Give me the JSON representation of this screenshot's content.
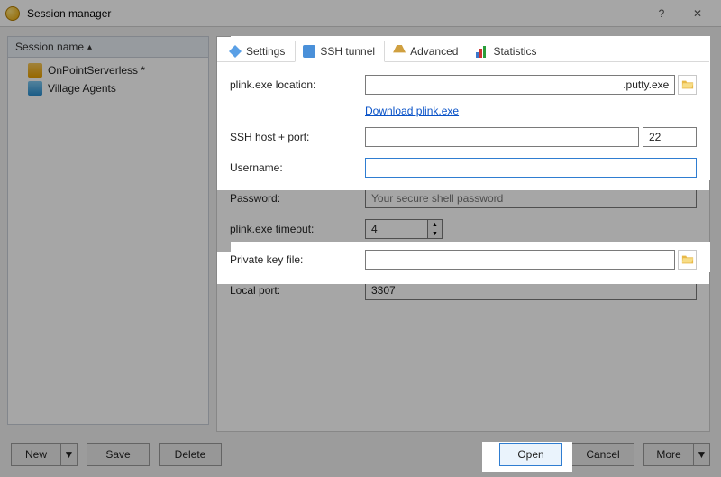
{
  "window": {
    "title": "Session manager",
    "help_symbol": "?",
    "close_symbol": "✕"
  },
  "sidebar": {
    "header": "Session name",
    "sort_indicator": "▴",
    "items": [
      {
        "label": "OnPointServerless *"
      },
      {
        "label": "Village Agents"
      }
    ]
  },
  "tabs": {
    "settings": "Settings",
    "ssh_tunnel": "SSH tunnel",
    "advanced": "Advanced",
    "statistics": "Statistics"
  },
  "form": {
    "plink_location_label": "plink.exe location:",
    "plink_location_value": ".putty.exe",
    "download_link": "Download plink.exe",
    "ssh_host_label": "SSH host + port:",
    "ssh_host_value": "",
    "ssh_port_value": "22",
    "username_label": "Username:",
    "username_value": "",
    "password_label": "Password:",
    "password_placeholder": "Your secure shell password",
    "timeout_label": "plink.exe timeout:",
    "timeout_value": "4",
    "private_key_label": "Private key file:",
    "private_key_value": "",
    "local_port_label": "Local port:",
    "local_port_value": "3307"
  },
  "footer": {
    "new": "New",
    "save": "Save",
    "delete": "Delete",
    "open": "Open",
    "cancel": "Cancel",
    "more": "More",
    "dropdown_symbol": "▼"
  }
}
